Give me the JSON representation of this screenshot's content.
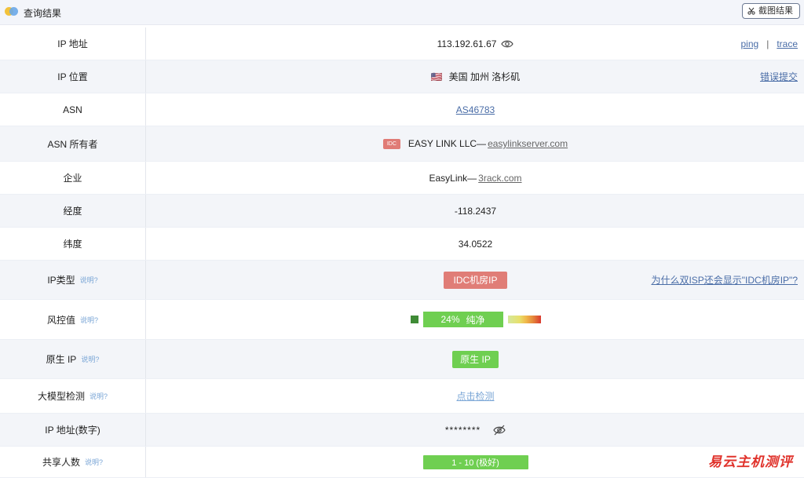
{
  "header": {
    "title": "查询结果",
    "screenshot_button": "截图结果"
  },
  "help_text": "说明?",
  "rows": {
    "ip": {
      "label": "IP 地址",
      "value": "113.192.61.67",
      "ping": "ping",
      "sep": "|",
      "trace": "trace"
    },
    "location": {
      "label": "IP 位置",
      "flag": "🇺🇸",
      "value": "美国 加州 洛杉矶",
      "action": "错误提交"
    },
    "asn": {
      "label": "ASN",
      "value": "AS46783"
    },
    "asn_owner": {
      "label": "ASN 所有者",
      "tag": "IDC",
      "name": "EASY LINK LLC—",
      "domain": "easylinkserver.com"
    },
    "company": {
      "label": "企业",
      "name": "EasyLink—",
      "domain": "3rack.com"
    },
    "longitude": {
      "label": "经度",
      "value": "-118.2437"
    },
    "latitude": {
      "label": "纬度",
      "value": "34.0522"
    },
    "ip_type": {
      "label": "IP类型",
      "value": "IDC机房IP",
      "question": "为什么双ISP还会显示\"IDC机房IP\"?"
    },
    "risk": {
      "label": "风控值",
      "percent": "24%",
      "level": "纯净"
    },
    "native_ip": {
      "label": "原生 IP",
      "value": "原生 IP"
    },
    "llm_check": {
      "label": "大模型检测",
      "action": "点击检测"
    },
    "ip_numeric": {
      "label": "IP 地址(数字)",
      "value": "********"
    },
    "shared_users": {
      "label": "共享人数",
      "value": "1 - 10 (极好)"
    }
  },
  "colors": {
    "green": "#6fcf51",
    "red_tag": "#e07d77",
    "link": "#4a6da7"
  },
  "watermark": "易云主机测评"
}
